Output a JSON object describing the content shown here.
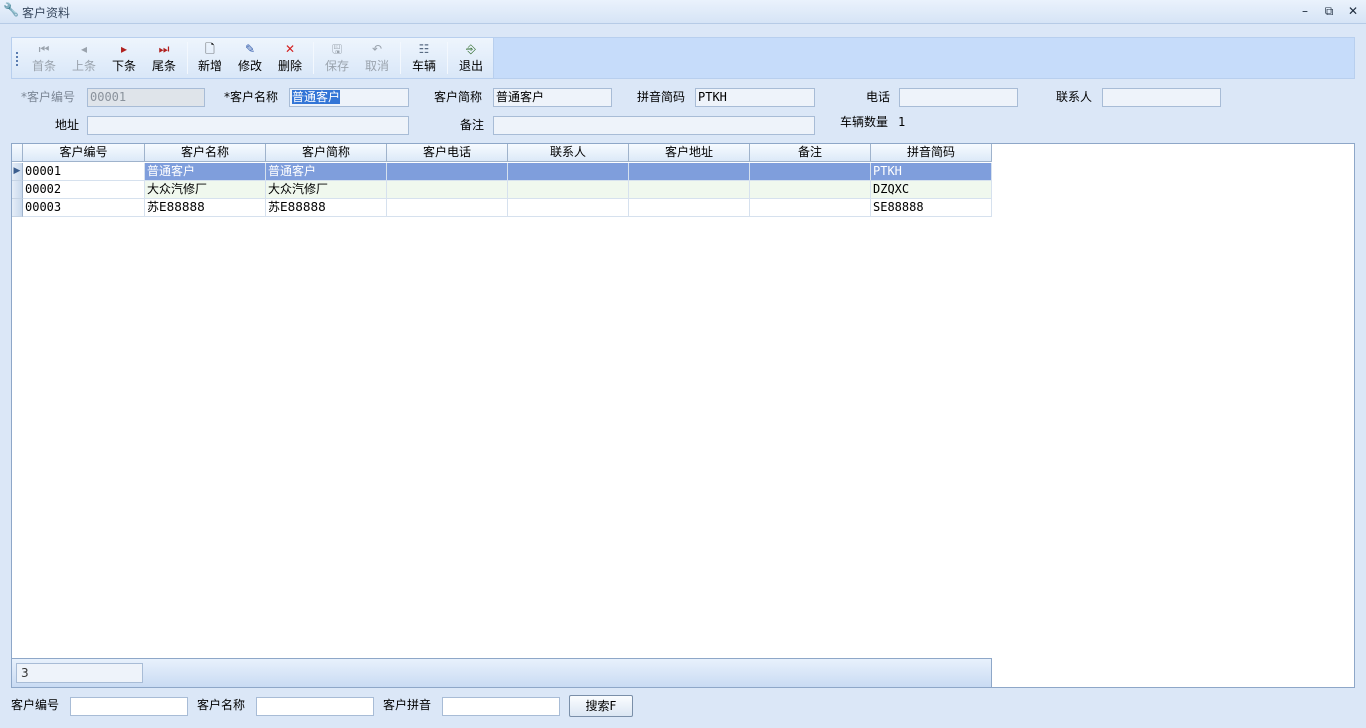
{
  "window": {
    "title": "客户资料"
  },
  "toolbar": {
    "first": "首条",
    "prev": "上条",
    "next": "下条",
    "last": "尾条",
    "add": "新增",
    "edit": "修改",
    "delete": "删除",
    "save": "保存",
    "cancel": "取消",
    "vehicle": "车辆",
    "exit": "退出"
  },
  "form": {
    "code_label": "*客户编号",
    "code_value": "00001",
    "name_label": "*客户名称",
    "name_value": "普通客户",
    "short_label": "客户简称",
    "short_value": "普通客户",
    "pinyin_label": "拼音简码",
    "pinyin_value": "PTKH",
    "phone_label": "电话",
    "phone_value": "",
    "contact_label": "联系人",
    "contact_value": "",
    "address_label": "地址",
    "address_value": "",
    "remark_label": "备注",
    "remark_value": "",
    "vehicle_count_label": "车辆数量",
    "vehicle_count_value": "1"
  },
  "grid": {
    "columns": [
      "客户编号",
      "客户名称",
      "客户简称",
      "客户电话",
      "联系人",
      "客户地址",
      "备注",
      "拼音简码"
    ],
    "rows": [
      [
        "00001",
        "普通客户",
        "普通客户",
        "",
        "",
        "",
        "",
        "PTKH"
      ],
      [
        "00002",
        "大众汽修厂",
        "大众汽修厂",
        "",
        "",
        "",
        "",
        "DZQXC"
      ],
      [
        "00003",
        "苏E88888",
        "苏E88888",
        "",
        "",
        "",
        "",
        "SE88888"
      ]
    ],
    "record_count": "3"
  },
  "search": {
    "code_label": "客户编号",
    "name_label": "客户名称",
    "pinyin_label": "客户拼音",
    "button": "搜索F"
  }
}
